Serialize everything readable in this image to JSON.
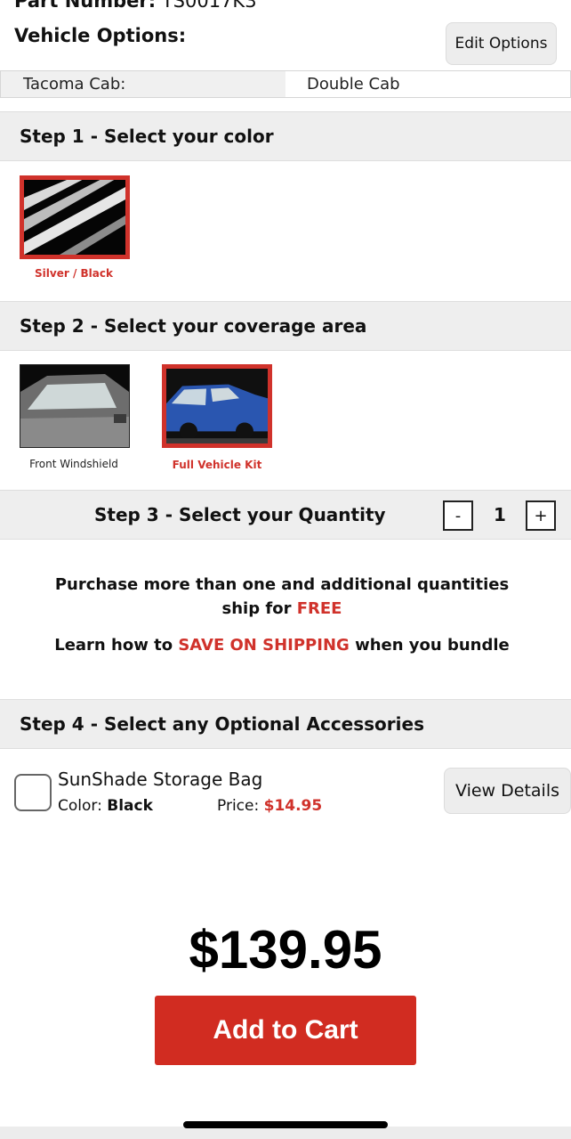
{
  "header": {
    "part_number_label": "Part Number:",
    "part_number_value": "TS0017K3",
    "vehicle_options_title": "Vehicle Options:",
    "edit_options_label": "Edit Options"
  },
  "vehicle_option": {
    "label": "Tacoma Cab:",
    "value": "Double Cab"
  },
  "steps": {
    "step1": "Step 1 - Select your color",
    "step2": "Step 2 - Select your coverage area",
    "step3": "Step 3 - Select your Quantity",
    "step4": "Step 4 - Select any Optional Accessories"
  },
  "colors": [
    {
      "label": "Silver / Black",
      "selected": true
    }
  ],
  "coverage": [
    {
      "label": "Front Windshield",
      "selected": false
    },
    {
      "label": "Full Vehicle Kit",
      "selected": true
    }
  ],
  "quantity": {
    "minus": "-",
    "value": "1",
    "plus": "+"
  },
  "promo": {
    "line1_prefix": "Purchase more than one and additional quantities ship for ",
    "line1_highlight": "FREE",
    "line2_prefix": "Learn how to ",
    "line2_highlight": "SAVE ON SHIPPING",
    "line2_suffix": " when you bundle"
  },
  "accessory": {
    "name": "SunShade Storage Bag",
    "color_label": "Color:",
    "color_value": "Black",
    "price_label": "Price:",
    "price_value": "$14.95",
    "view_details_label": "View Details",
    "checked": false
  },
  "total": {
    "price": "$139.95",
    "add_to_cart_label": "Add to Cart"
  },
  "colors_theme": {
    "accent_red": "#d0322b",
    "button_red": "#d12c21",
    "step_bar_bg": "#eeeeee"
  }
}
